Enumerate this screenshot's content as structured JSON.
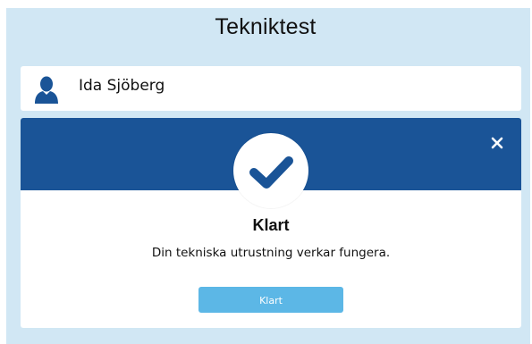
{
  "page": {
    "title": "Tekniktest"
  },
  "user": {
    "name": "Ida Sjöberg",
    "avatar_icon": "user-silhouette-icon"
  },
  "modal": {
    "heading": "Klart",
    "message": "Din tekniska utrustning verkar fungera.",
    "button_label": "Klart",
    "status_icon": "checkmark-icon",
    "close_icon": "close-icon"
  },
  "colors": {
    "background": "#d1e7f4",
    "header": "#1a5497",
    "button": "#5cb7e6",
    "check": "#1a5497"
  }
}
